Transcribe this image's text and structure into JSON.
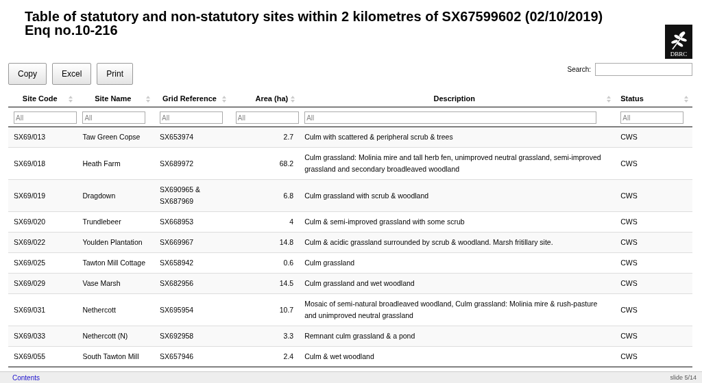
{
  "title": "Table of statutory and non-statutory sites within 2 kilometres of SX67599602 (02/10/2019)",
  "subtitle": "Enq no.10-216",
  "logo": {
    "text": "DBRC"
  },
  "buttons": [
    "Copy",
    "Excel",
    "Print"
  ],
  "search": {
    "label": "Search:"
  },
  "table": {
    "columns": [
      {
        "label": "Site Code"
      },
      {
        "label": "Site Name"
      },
      {
        "label": "Grid Reference"
      },
      {
        "label": "Area (ha)"
      },
      {
        "label": "Description"
      },
      {
        "label": "Status"
      }
    ],
    "filters": [
      {
        "placeholder": "All"
      },
      {
        "placeholder": "All"
      },
      {
        "placeholder": "All"
      },
      {
        "placeholder": "All"
      },
      {
        "placeholder": "All"
      },
      {
        "placeholder": "All"
      }
    ],
    "rows": [
      {
        "cells": [
          "SX69/013",
          "Taw Green Copse",
          "SX653974",
          "2.7",
          "Culm with scattered & peripheral scrub & trees",
          "CWS"
        ]
      },
      {
        "cells": [
          "SX69/018",
          "Heath Farm",
          "SX689972",
          "68.2",
          "Culm grassland: Molinia mire and tall herb fen, unimproved neutral grassland, semi-improved grassland and secondary broadleaved woodland",
          "CWS"
        ]
      },
      {
        "cells": [
          "SX69/019",
          "Dragdown",
          "SX690965 & SX687969",
          "6.8",
          "Culm grassland with scrub & woodland",
          "CWS"
        ]
      },
      {
        "cells": [
          "SX69/020",
          "Trundlebeer",
          "SX668953",
          "4",
          "Culm & semi-improved grassland with some scrub",
          "CWS"
        ]
      },
      {
        "cells": [
          "SX69/022",
          "Youlden Plantation",
          "SX669967",
          "14.8",
          "Culm & acidic grassland surrounded by scrub & woodland. Marsh fritillary site.",
          "CWS"
        ]
      },
      {
        "cells": [
          "SX69/025",
          "Tawton Mill Cottage",
          "SX658942",
          "0.6",
          "Culm grassland",
          "CWS"
        ]
      },
      {
        "cells": [
          "SX69/029",
          "Vase Marsh",
          "SX682956",
          "14.5",
          "Culm grassland and wet woodland",
          "CWS"
        ]
      },
      {
        "cells": [
          "SX69/031",
          "Nethercott",
          "SX695954",
          "10.7",
          "Mosaic of semi-natural broadleaved woodland, Culm grassland: Molinia mire & rush-pasture and unimproved neutral grassland",
          "CWS"
        ]
      },
      {
        "cells": [
          "SX69/033",
          "Nethercott (N)",
          "SX692958",
          "3.3",
          "Remnant culm grassland & a pond",
          "CWS"
        ]
      },
      {
        "cells": [
          "SX69/055",
          "South Tawton Mill",
          "SX657946",
          "2.4",
          "Culm & wet woodland",
          "CWS"
        ]
      }
    ]
  },
  "footer": {
    "link": "Contents",
    "slide": "slide 5/14"
  }
}
